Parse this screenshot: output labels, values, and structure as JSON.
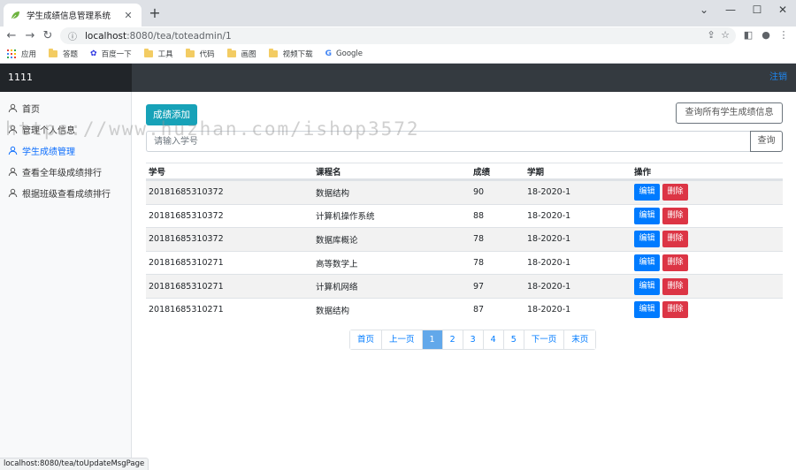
{
  "browser": {
    "tab_title": "学生成绩信息管理系统",
    "url_host": "localhost",
    "url_path": ":8080/tea/toteadmin/1",
    "status_url": "localhost:8080/tea/toUpdateMsgPage",
    "bookmarks": [
      {
        "label": "应用",
        "icon": "apps-icon"
      },
      {
        "label": "答题",
        "icon": "folder-icon"
      },
      {
        "label": "百度一下",
        "icon": "baidu-icon"
      },
      {
        "label": "工具",
        "icon": "folder-icon"
      },
      {
        "label": "代码",
        "icon": "folder-icon"
      },
      {
        "label": "画图",
        "icon": "folder-icon"
      },
      {
        "label": "视频下载",
        "icon": "folder-icon"
      },
      {
        "label": "Google",
        "icon": "google-icon"
      }
    ]
  },
  "app": {
    "brand": "1111",
    "logout": "注销"
  },
  "sidebar": {
    "items": [
      {
        "label": "首页",
        "active": false
      },
      {
        "label": "管理个人信息",
        "active": false
      },
      {
        "label": "学生成绩管理",
        "active": true
      },
      {
        "label": "查看全年级成绩排行",
        "active": false
      },
      {
        "label": "根据班级查看成绩排行",
        "active": false
      }
    ]
  },
  "main": {
    "add_button": "成绩添加",
    "query_all_button": "查询所有学生成绩信息",
    "search_placeholder": "请输入学号",
    "search_button": "查询",
    "table": {
      "headers": [
        "学号",
        "课程名",
        "成绩",
        "学期",
        "操作"
      ],
      "edit_label": "编辑",
      "delete_label": "删除",
      "rows": [
        [
          "20181685310372",
          "数据结构",
          "90",
          "18-2020-1"
        ],
        [
          "20181685310372",
          "计算机操作系统",
          "88",
          "18-2020-1"
        ],
        [
          "20181685310372",
          "数据库概论",
          "78",
          "18-2020-1"
        ],
        [
          "20181685310271",
          "高等数学上",
          "78",
          "18-2020-1"
        ],
        [
          "20181685310271",
          "计算机网络",
          "97",
          "18-2020-1"
        ],
        [
          "20181685310271",
          "数据结构",
          "87",
          "18-2020-1"
        ]
      ]
    },
    "pagination": [
      "首页",
      "上一页",
      "1",
      "2",
      "3",
      "4",
      "5",
      "下一页",
      "末页"
    ],
    "active_page": "1"
  },
  "watermark": "https://www.huzhan.com/ishop3572",
  "colors": {
    "accent": "#17a2b8",
    "primary": "#007bff",
    "danger": "#dc3545",
    "navbar": "#343a40"
  }
}
